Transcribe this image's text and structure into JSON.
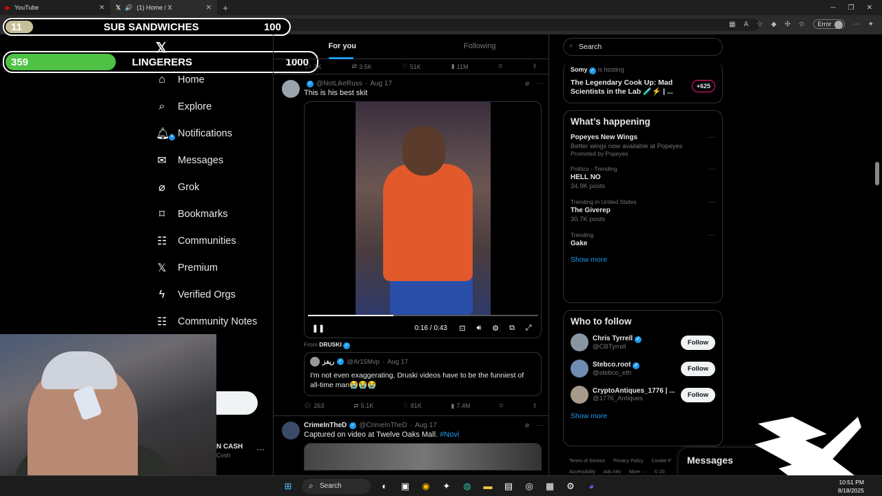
{
  "browser": {
    "tabs": [
      {
        "title": "YouTube",
        "icon": "youtube-icon"
      },
      {
        "title": "(1) Home / X",
        "icon": "x-icon"
      }
    ],
    "url": "https://x.com/home",
    "error_label": "Error"
  },
  "overlay": {
    "bar1": {
      "count": "11",
      "label": "SUB SANDWICHES",
      "goal": "100",
      "progress": 0.11
    },
    "bar2": {
      "count": "359",
      "label": "LINGERERS",
      "goal": "1000",
      "progress": 0.359
    }
  },
  "nav": {
    "logo": "X",
    "items": [
      {
        "label": "Home",
        "icon": "home-icon"
      },
      {
        "label": "Explore",
        "icon": "search-icon"
      },
      {
        "label": "Notifications",
        "icon": "bell-icon",
        "badge": "1"
      },
      {
        "label": "Messages",
        "icon": "mail-icon"
      },
      {
        "label": "Grok",
        "icon": "grok-icon"
      },
      {
        "label": "Bookmarks",
        "icon": "bookmark-icon"
      },
      {
        "label": "Communities",
        "icon": "communities-icon"
      },
      {
        "label": "Premium",
        "icon": "x-premium-icon"
      },
      {
        "label": "Verified Orgs",
        "icon": "lightning-icon"
      },
      {
        "label": "Community Notes",
        "icon": "community-notes-icon"
      }
    ],
    "account": {
      "name": "N CASH",
      "handle": "Cvsh"
    }
  },
  "timeline": {
    "tabs": [
      "For you",
      "Following"
    ],
    "top_actions": {
      "replies": "3K",
      "reposts": "3.5K",
      "likes": "51K",
      "views": "11M"
    },
    "tweet1": {
      "name": "",
      "handle": "@NotLikeRuss",
      "date": "Aug 17",
      "text": "This is his best skit",
      "video_time": "0:16 / 0:43",
      "video_progress": 0.37,
      "from_label": "From",
      "from_name": "DRUSKI",
      "quote": {
        "name": "ريفز",
        "handle": "@Ar15Mvp",
        "date": "Aug 17",
        "text": "I'm not even exaggerating, Druski videos have to be the funniest of all-time man😭😭😭"
      },
      "actions": {
        "replies": "263",
        "reposts": "5.1K",
        "likes": "81K",
        "views": "7.4M"
      }
    },
    "tweet2": {
      "name": "CrimeInTheD",
      "handle": "@CrimeInTheD",
      "date": "Aug 17",
      "text": "Captured on video at Twelve Oaks Mall.",
      "hashtag": "#Novi"
    }
  },
  "sidebar": {
    "search_placeholder": "Search",
    "space": {
      "host": "Somy",
      "host_suffix": "is hosting",
      "title": "The Legendary Cook Up: Mad Scientists in the Lab 🧪⚡ | ...",
      "count": "+625"
    },
    "happening": {
      "title": "What’s happening",
      "trends": [
        {
          "context": "",
          "title": "Popeyes New Wings",
          "sub": "Better wings now available at Popeyes",
          "promo": "Promoted by Popeyes"
        },
        {
          "context": "Politics · Trending",
          "title": "HELL NO",
          "sub": "34.9K posts",
          "promo": ""
        },
        {
          "context": "Trending in United States",
          "title": "The Giverep",
          "sub": "30.7K posts",
          "promo": ""
        },
        {
          "context": "Trending",
          "title": "Gake",
          "sub": "",
          "promo": ""
        }
      ],
      "show_more": "Show more"
    },
    "who_to_follow": {
      "title": "Who to follow",
      "users": [
        {
          "name": "Chris Tyrrell",
          "handle": "@CBTyrrell"
        },
        {
          "name": "Stebco.root",
          "handle": "@stebco_eth"
        },
        {
          "name": "CryptoAntiques_1776 | ...",
          "handle": "@1776_Antiques"
        }
      ],
      "follow_label": "Follow",
      "show_more": "Show more"
    },
    "footer": [
      "Terms of Service",
      "Privacy Policy",
      "Cookie P",
      "Accessibility",
      "Ads info",
      "More ···",
      "© 20"
    ]
  },
  "messages_drawer": "Messages",
  "taskbar": {
    "search": "Search",
    "time": "10:51 PM",
    "date": "8/18/2025"
  }
}
